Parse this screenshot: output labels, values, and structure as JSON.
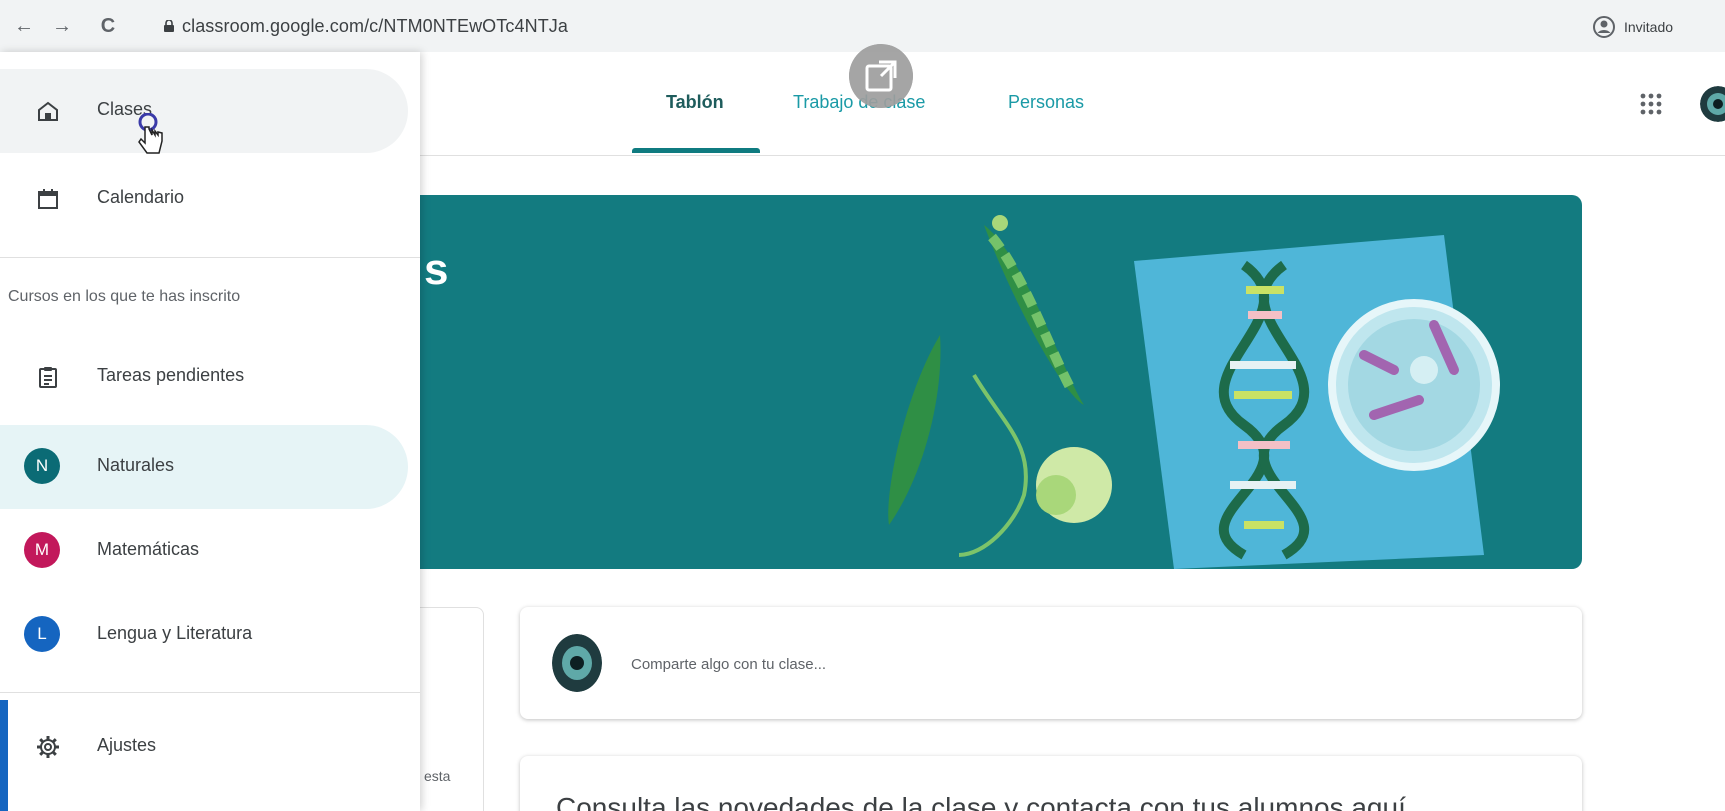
{
  "browser": {
    "url": "classroom.google.com/c/NTM0NTEwOTc4NTJa",
    "profile_label": "Invitado",
    "back_glyph": "←",
    "forward_glyph": "→",
    "reload_glyph": "C"
  },
  "header": {
    "tabs": [
      {
        "label": "Tablón",
        "active": true
      },
      {
        "label": "Trabajo de clase",
        "active": false
      },
      {
        "label": "Personas",
        "active": false
      }
    ]
  },
  "drawer": {
    "top_items": [
      {
        "label": "Clases",
        "icon": "home-icon",
        "hover": true
      },
      {
        "label": "Calendario",
        "icon": "calendar-icon"
      }
    ],
    "section_title": "Cursos en los que te has inscrito",
    "courses": [
      {
        "label": "Tareas pendientes",
        "icon": "clipboard-icon"
      },
      {
        "label": "Naturales",
        "initial": "N",
        "color": "#0b6b75",
        "selected": true
      },
      {
        "label": "Matemáticas",
        "initial": "M",
        "color": "#c2185b"
      },
      {
        "label": "Lengua y Literatura",
        "initial": "L",
        "color": "#1565c0"
      }
    ],
    "settings_label": "Ajustes"
  },
  "banner": {
    "partial_title": "s",
    "color": "#137b80"
  },
  "stream": {
    "share_placeholder": "Comparte algo con tu clase...",
    "info_text": "Consulta las novedades de la clase y contacta con tus alumnos aquí",
    "left_card_text": "esta"
  },
  "colors": {
    "accent": "#0f7b80",
    "tab_inactive": "#1a9aa6"
  }
}
